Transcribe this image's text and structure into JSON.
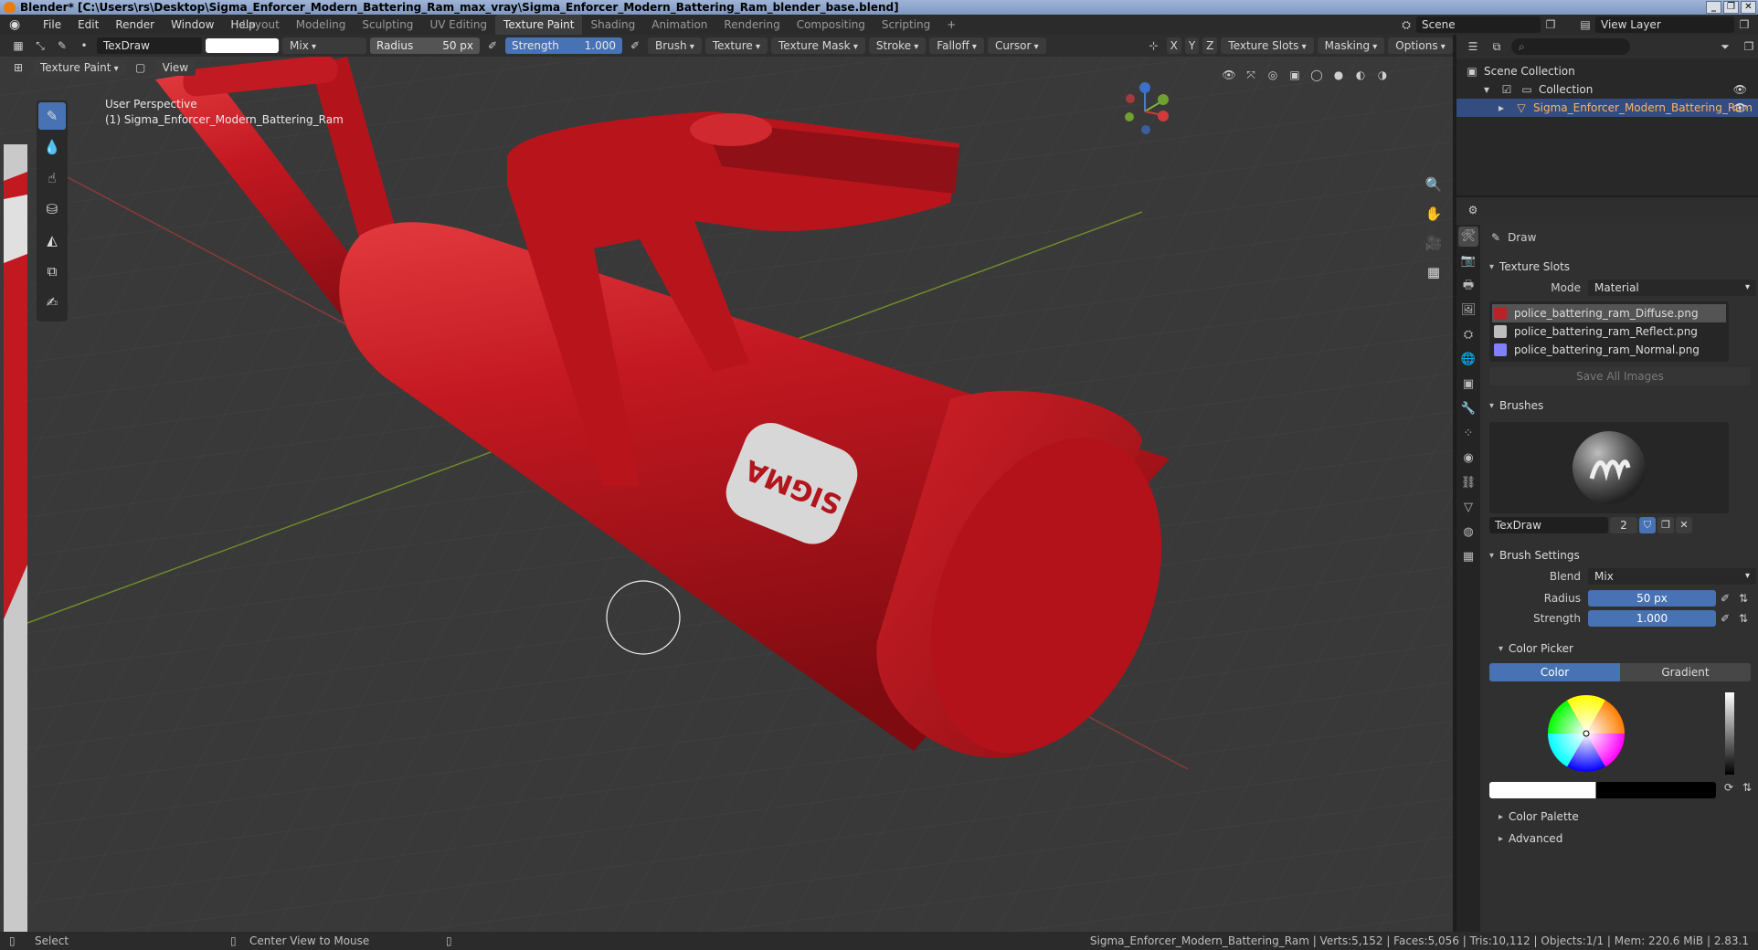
{
  "window": {
    "title": "Blender* [C:\\Users\\rs\\Desktop\\Sigma_Enforcer_Modern_Battering_Ram_max_vray\\Sigma_Enforcer_Modern_Battering_Ram_blender_base.blend]",
    "buttons": [
      "_",
      "❐",
      "✕"
    ]
  },
  "menu": [
    "File",
    "Edit",
    "Render",
    "Window",
    "Help"
  ],
  "workspaces": [
    {
      "label": "Layout",
      "active": false
    },
    {
      "label": "Modeling",
      "active": false
    },
    {
      "label": "Sculpting",
      "active": false
    },
    {
      "label": "UV Editing",
      "active": false
    },
    {
      "label": "Texture Paint",
      "active": true
    },
    {
      "label": "Shading",
      "active": false
    },
    {
      "label": "Animation",
      "active": false
    },
    {
      "label": "Rendering",
      "active": false
    },
    {
      "label": "Compositing",
      "active": false
    },
    {
      "label": "Scripting",
      "active": false
    }
  ],
  "scene": {
    "name": "Scene",
    "view_layer": "View Layer"
  },
  "tool_header": {
    "brush_name": "TexDraw",
    "blend": "Mix",
    "radius_label": "Radius",
    "radius_value": "50 px",
    "strength_label": "Strength",
    "strength_value": "1.000",
    "menus": [
      "Brush",
      "Texture",
      "Texture Mask",
      "Stroke",
      "Falloff",
      "Cursor"
    ],
    "axes": [
      "X",
      "Y",
      "Z"
    ],
    "right_menus": [
      "Texture Slots",
      "Masking",
      "Options"
    ]
  },
  "viewport_header": {
    "mode": "Texture Paint",
    "view_menu": "View"
  },
  "viewport": {
    "perspective": "User Perspective",
    "object_label": "(1) Sigma_Enforcer_Modern_Battering_Ram",
    "label_text": "SIGMA",
    "colors": {
      "ram_red": "#c0131b",
      "grid_bg": "#3a3a3a",
      "axis_x": "#8a3a3a",
      "axis_y": "#6f8a2c"
    }
  },
  "outliner": {
    "root": "Scene Collection",
    "collection": "Collection",
    "object": "Sigma_Enforcer_Modern_Battering_Ram"
  },
  "properties": {
    "tool_name": "Draw",
    "texture_slots": {
      "title": "Texture Slots",
      "mode_label": "Mode",
      "mode_value": "Material",
      "slots": [
        {
          "name": "police_battering_ram_Diffuse.png",
          "color": "#b8232a",
          "selected": true
        },
        {
          "name": "police_battering_ram_Reflect.png",
          "color": "#bdbdbd",
          "selected": false
        },
        {
          "name": "police_battering_ram_Normal.png",
          "color": "#8080ff",
          "selected": false
        }
      ],
      "save_all": "Save All Images"
    },
    "brushes": {
      "title": "Brushes",
      "brush_name": "TexDraw",
      "users": "2"
    },
    "brush_settings": {
      "title": "Brush Settings",
      "blend_label": "Blend",
      "blend_value": "Mix",
      "radius_label": "Radius",
      "radius_value": "50 px",
      "strength_label": "Strength",
      "strength_value": "1.000",
      "color_picker": "Color Picker",
      "color_tab": "Color",
      "gradient_tab": "Gradient",
      "color_palette": "Color Palette",
      "advanced": "Advanced"
    }
  },
  "status": {
    "select": "Select",
    "center_view": "Center View to Mouse",
    "info": "Sigma_Enforcer_Modern_Battering_Ram | Verts:5,152 | Faces:5,056 | Tris:10,112 | Objects:1/1 | Mem: 220.6 MiB | 2.83.1"
  }
}
